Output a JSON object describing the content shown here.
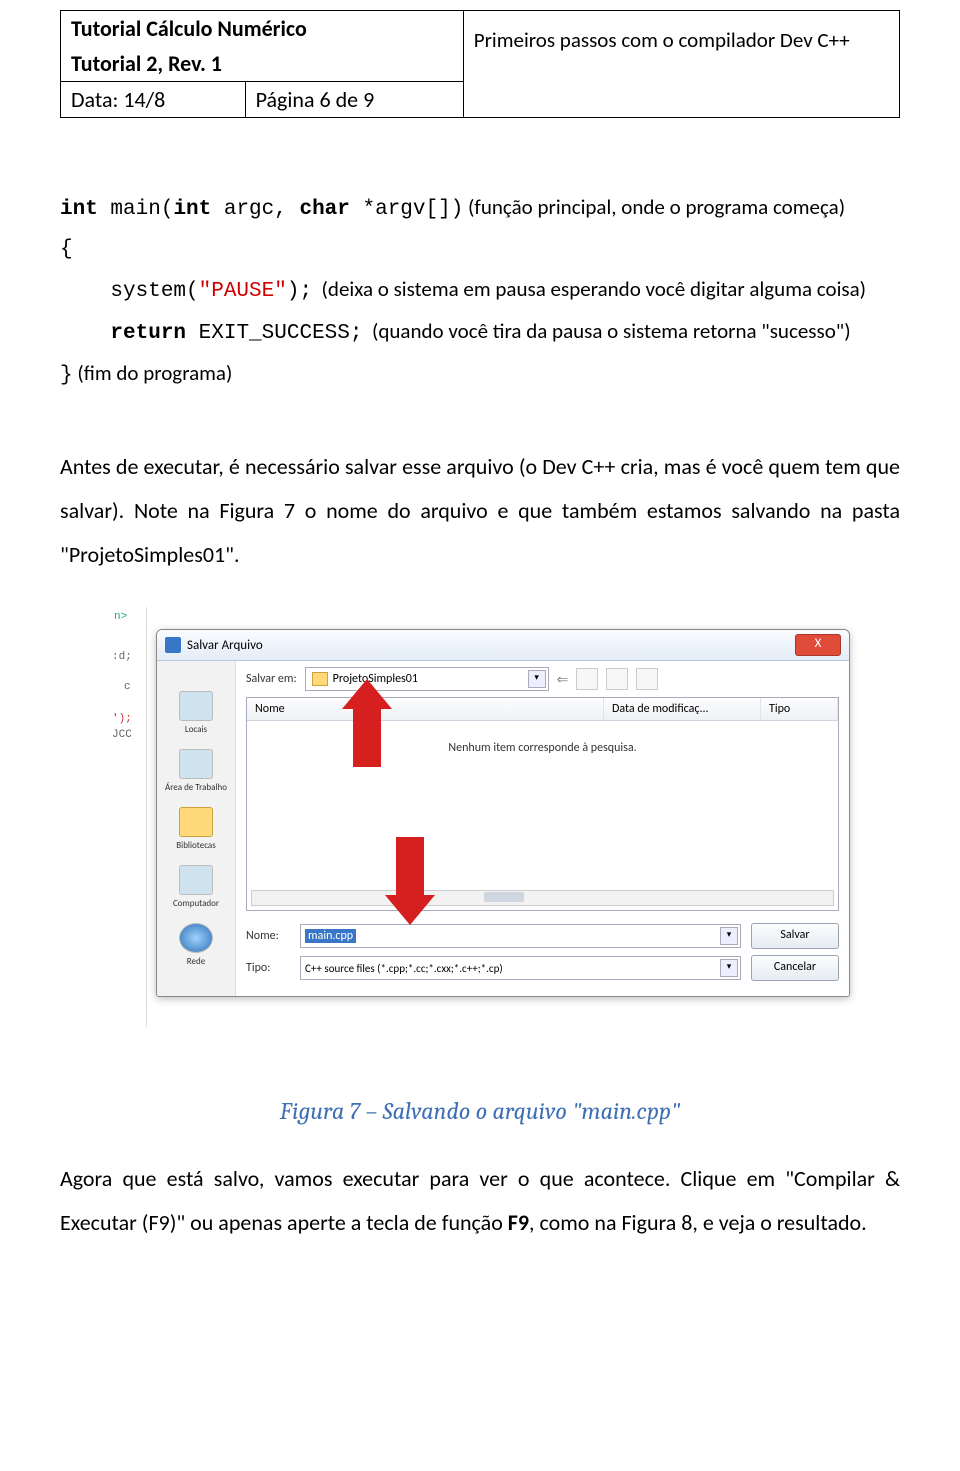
{
  "header": {
    "line1": "Tutorial Cálculo Numérico",
    "line2": "Tutorial 2, Rev. 1",
    "right": "Primeiros passos com o compilador Dev C++",
    "date": "Data: 14/8",
    "page": "Página 6 de 9"
  },
  "code": {
    "l1a": "int",
    "l1b": " main(",
    "l1c": "int",
    "l1d": " argc, ",
    "l1e": "char",
    "l1f": " *argv[])",
    "l1cmt": " (função principal, onde o programa começa)",
    "l2": "{",
    "l3a": "    system(",
    "l3b": "\"PAUSE\"",
    "l3c": ");",
    "l3cmt": "  (deixa o sistema em pausa esperando você digitar alguma coisa)",
    "l4a": "    ",
    "l4b": "return",
    "l4c": " EXIT_SUCCESS;",
    "l4cmt": "  (quando você tira da pausa o sistema retorna \"sucesso\")",
    "l5": "}",
    "l5cmt": " (fim do programa)"
  },
  "para": "Antes de executar, é necessário salvar esse arquivo (o Dev C++ cria, mas é você quem tem que salvar). Note na Figura 7 o nome do arquivo e que também estamos salvando na pasta \"ProjetoSimples01\".",
  "shot": {
    "edge": {
      "a": "n>",
      "b": ":d;",
      "c": "c",
      "d": "');",
      "e": "JCC"
    },
    "title": "Salvar Arquivo",
    "close": "X",
    "salvar_em_label": "Salvar em:",
    "folder_name": "ProjetoSimples01",
    "col_nome": "Nome",
    "col_data": "Data de modificaç...",
    "col_tipo": "Tipo",
    "empty": "Nenhum item corresponde à pesquisa.",
    "places": {
      "locais": "Locais",
      "area": "Área de Trabalho",
      "bibl": "Bibliotecas",
      "comp": "Computador",
      "rede": "Rede"
    },
    "nome_label": "Nome:",
    "nome_value": "main.cpp",
    "tipo_label": "Tipo:",
    "tipo_value": "C++ source files (*.cpp;*.cc;*.cxx;*.c++;*.cp)",
    "btn_salvar": "Salvar",
    "btn_cancelar": "Cancelar"
  },
  "caption": "Figura 7 – Salvando o arquivo \"main.cpp\"",
  "para2a": "Agora que está salvo, vamos executar para ver o que acontece. Clique em \"Compilar & Executar (F9)\" ou apenas aperte a tecla de função ",
  "para2b": "F9",
  "para2c": ", como na Figura 8, e veja o resultado."
}
